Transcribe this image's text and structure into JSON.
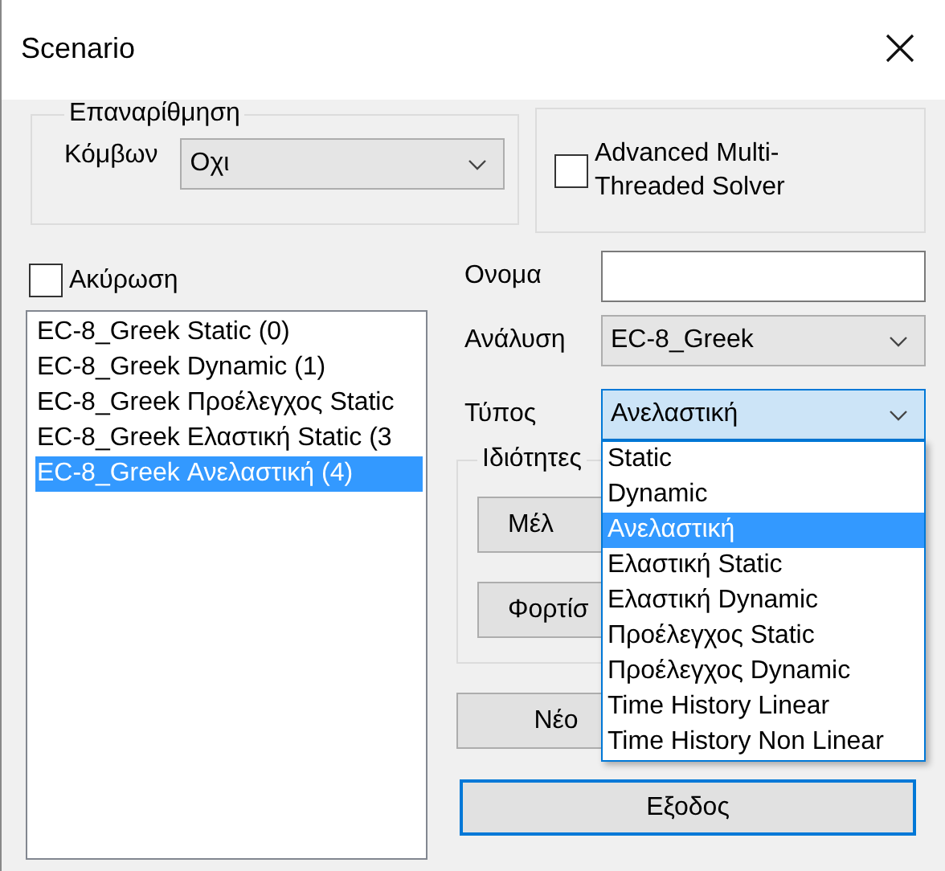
{
  "window": {
    "title": "Scenario"
  },
  "renumbering": {
    "title": "Επαναρίθμηση",
    "label": "Κόμβων",
    "value": "Οχι"
  },
  "advanced_solver": {
    "label": "Advanced Multi-Threaded Solver",
    "checked": false
  },
  "cancel": {
    "label": "Ακύρωση",
    "checked": false
  },
  "scenarios": [
    {
      "label": "EC-8_Greek Static (0)",
      "selected": false
    },
    {
      "label": "EC-8_Greek Dynamic (1)",
      "selected": false
    },
    {
      "label": "EC-8_Greek Προέλεγχος Static",
      "selected": false
    },
    {
      "label": "EC-8_Greek Ελαστική Static (3",
      "selected": false
    },
    {
      "label": "EC-8_Greek Ανελαστική (4)",
      "selected": true
    }
  ],
  "name_field": {
    "label": "Ονομα"
  },
  "analysis": {
    "label": "Ανάλυση",
    "value": "EC-8_Greek"
  },
  "type": {
    "label": "Τύπος",
    "value": "Ανελαστική",
    "expanded": true,
    "options": [
      {
        "label": "Static",
        "selected": false
      },
      {
        "label": "Dynamic",
        "selected": false
      },
      {
        "label": "Ανελαστική",
        "selected": true
      },
      {
        "label": "Ελαστική Static",
        "selected": false
      },
      {
        "label": "Ελαστική Dynamic",
        "selected": false
      },
      {
        "label": "Προέλεγχος Static",
        "selected": false
      },
      {
        "label": "Προέλεγχος Dynamic",
        "selected": false
      },
      {
        "label": "Time History Linear",
        "selected": false
      },
      {
        "label": "Time History Non Linear",
        "selected": false
      }
    ]
  },
  "properties": {
    "title": "Ιδιότητες",
    "buttons": [
      "Μέλ",
      "Φορτίσ"
    ]
  },
  "buttons": [
    {
      "label": "Νέο",
      "default": false
    },
    {
      "label": "Εξοδος",
      "default": true
    }
  ]
}
